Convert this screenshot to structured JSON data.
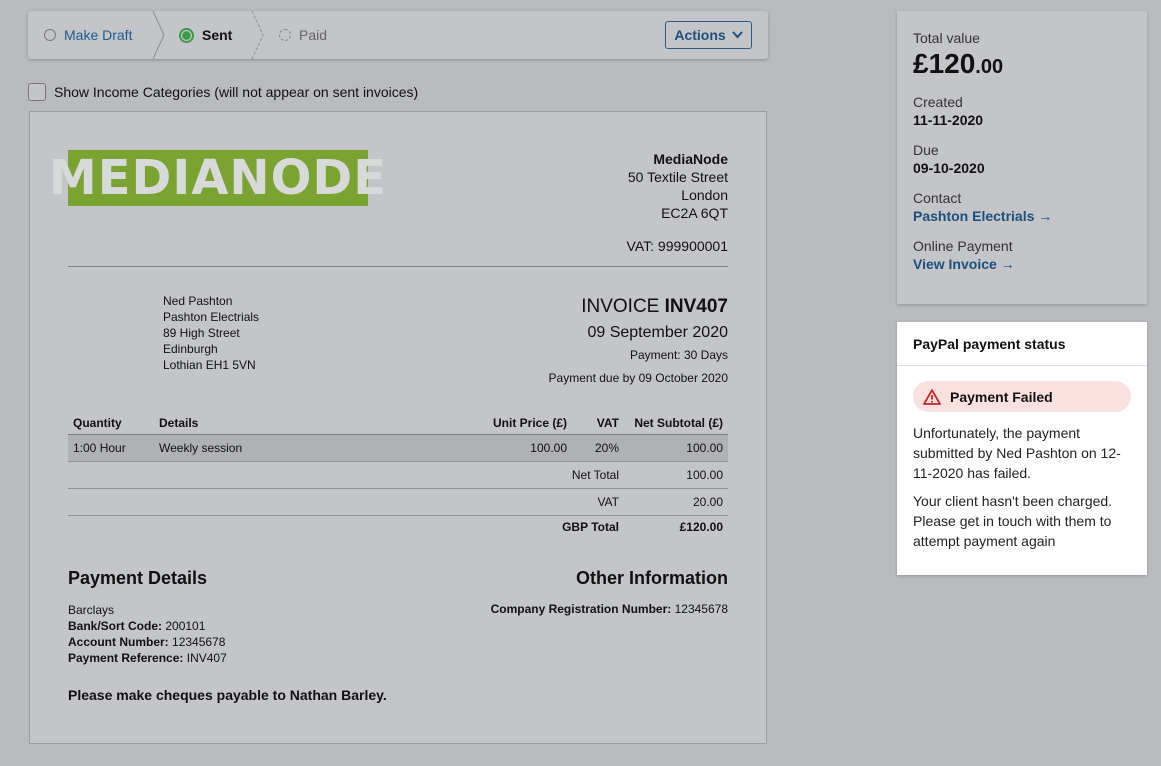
{
  "workflow": {
    "steps": [
      "Make Draft",
      "Sent",
      "Paid"
    ],
    "actions_label": "Actions"
  },
  "categories_toggle": {
    "label": "Show Income Categories (will not appear on sent invoices)"
  },
  "invoice": {
    "logo_text": "MEDIANODE",
    "from": {
      "name": "MediaNode",
      "street": "50 Textile Street",
      "city": "London",
      "postcode": "EC2A 6QT",
      "vat": "VAT: 999900001"
    },
    "to": [
      "Ned Pashton",
      "Pashton Electrials",
      "89 High Street",
      "Edinburgh",
      "Lothian EH1 5VN"
    ],
    "title_prefix": "INVOICE",
    "number": "INV407",
    "date": "09 September 2020",
    "terms": "Payment: 30 Days",
    "due": "Payment due by 09 October 2020",
    "columns": [
      "Quantity",
      "Details",
      "Unit Price (£)",
      "VAT",
      "Net Subtotal (£)"
    ],
    "rows": [
      {
        "quantity": "1:00 Hour",
        "details": "Weekly session",
        "unit_price": "100.00",
        "vat": "20%",
        "subtotal": "100.00"
      }
    ],
    "totals": {
      "net_label": "Net Total",
      "net": "100.00",
      "vat_label": "VAT",
      "vat": "20.00",
      "gross_label": "GBP Total",
      "gross": "£120.00"
    },
    "payment_details": {
      "title": "Payment Details",
      "bank": "Barclays",
      "sort_label": "Bank/Sort Code:",
      "sort": "200101",
      "account_label": "Account Number:",
      "account": "12345678",
      "ref_label": "Payment Reference:",
      "ref": "INV407"
    },
    "other_info": {
      "title": "Other Information",
      "reg_label": "Company Registration Number:",
      "reg": "12345678"
    },
    "cheque_note": "Please make cheques payable to Nathan Barley."
  },
  "summary": {
    "total_label": "Total value",
    "total_main": "£120",
    "total_pence": ".00",
    "created_label": "Created",
    "created": "11-11-2020",
    "due_label": "Due",
    "due": "09-10-2020",
    "contact_label": "Contact",
    "contact_link": "Pashton Electrials →",
    "online_label": "Online Payment",
    "online_link": "View Invoice →"
  },
  "paypal": {
    "title": "PayPal payment status",
    "status": "Payment Failed",
    "message_1": "Unfortunately, the payment submitted by Ned Pashton on 12-11-2020 has failed.",
    "message_2": "Your client hasn't been charged. Please get in touch with them to attempt payment again"
  },
  "colors": {
    "brand": "#7aa332",
    "link": "#1e4f7a",
    "success": "#3b9a48",
    "error_bg": "#fbe0e0",
    "error": "#c62828"
  }
}
